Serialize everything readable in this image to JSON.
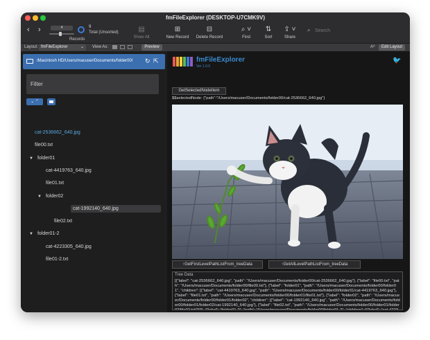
{
  "window": {
    "title": "fmFileExplorer (DESKTOP-U7CMK9V)"
  },
  "toolbar": {
    "record_number": "4",
    "record_count": "9",
    "record_status": "Total (Unsorted)",
    "records_label": "Records",
    "show_all": "Show All",
    "new_record": "New Record",
    "delete_record": "Delete Record",
    "find": "Find",
    "sort": "Sort",
    "share": "Share",
    "search_placeholder": "Search"
  },
  "layoutbar": {
    "layout_label": "Layout:",
    "layout_value": "fmFileExplorer",
    "view_as": "View As:",
    "preview": "Preview",
    "text_size": "Aᴬ",
    "edit_layout": "Edit Layout"
  },
  "pathbar": {
    "path": "/Macintosh HD/Users/macuser/Documents/folder00/"
  },
  "filter": {
    "placeholder": "Filter"
  },
  "tree": [
    {
      "label": "cat-2536662_640.jpg",
      "indent": 0,
      "type": "file",
      "selected_link": true
    },
    {
      "label": "file00.txt",
      "indent": 0,
      "type": "file"
    },
    {
      "label": "folder01",
      "indent": 0,
      "type": "folder"
    },
    {
      "label": "cat-4419763_640.jpg",
      "indent": 1,
      "type": "file"
    },
    {
      "label": "file01.txt",
      "indent": 1,
      "type": "file"
    },
    {
      "label": "folder02",
      "indent": 1,
      "type": "folder"
    },
    {
      "label": "cat-1992140_640.jpg",
      "indent": 2,
      "type": "file",
      "highlighted": true
    },
    {
      "label": "file02.txt",
      "indent": 2,
      "type": "file"
    },
    {
      "label": "folder01-2",
      "indent": 0,
      "type": "folder"
    },
    {
      "label": "cat-4223305_640.jpg",
      "indent": 1,
      "type": "file"
    },
    {
      "label": "file01-2.txt",
      "indent": 1,
      "type": "file"
    }
  ],
  "header": {
    "app_name": "fmFileExplorer",
    "version": "Ver 1.0.0"
  },
  "main": {
    "get_selected_button": "GetSelectedNodeItem",
    "selected_node_text": "$$selectedNode: {\"path\":\"/Users/macuser/Documents/folder00/cat-2536662_640.jpg\"}",
    "btn_first_level": "↑GetFirstLevelPathListFrom_treeData",
    "btn_all_level": "↑GetAllLevelPathListFrom_treeData",
    "tree_data_label": "Tree Data",
    "tree_data_text": "[{\"label\": \"cat-2536662_640.jpg\", \"path\": \"/Users/macuser/Documents/folder00/cat-2536662_640.jpg\"}, {\"label\": \"file00.txt\", \"path\": \"/Users/macuser/Documents/folder00/file00.txt\"}, {\"label\": \"folder01\", \"path\": \"/Users/macuser/Documents/folder00/folder01\", \"children\": [{\"label\": \"cat-4419763_640.jpg\", \"path\": \"/Users/macuser/Documents/folder00/folder01/cat-4419763_640.jpg\"}, {\"label\": \"file01.txt\", \"path\": \"/Users/macuser/Documents/folder00/folder01/file01.txt\"}, {\"label\": \"folder02\", \"path\": \"/Users/macuser/Documents/folder00/folder01/folder02\", \"children\": [{\"label\": \"cat-1992140_640.jpg\", \"path\": \"/Users/macuser/Documents/folder00/folder01/folder02/cat-1992140_640.jpg\"}, {\"label\": \"file02.txt\", \"path\": \"/Users/macuser/Documents/folder00/folder01/folder02/file02.txt\"}]}]}, {\"label\": \"folder01-2\", \"path\": \"/Users/macuser/Documents/folder00/folder01-2\", \"children\": [{\"label\": \"cat-4223305_640.jpg\", \"path\": \"/Users/macuser/Documents/folder00/folder01-2/cat-4223305_640.jpg\"}, {\"label\": \"file01-2.txt\", \"path\": \"/Users/macuser/Documents/folder00/folder01-2/file01-2.txt\"}]}]"
  },
  "colors": {
    "accent": "#3b6fb0",
    "link": "#5aa7e0",
    "background": "#1c1c1e"
  }
}
